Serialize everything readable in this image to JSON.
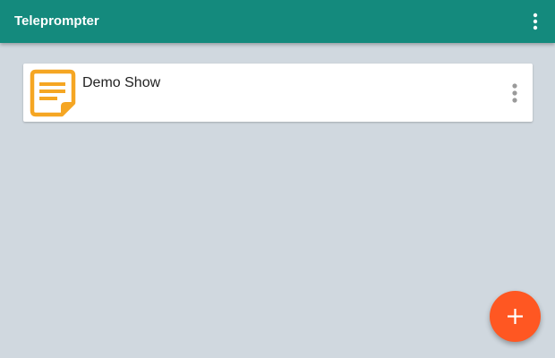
{
  "app_bar": {
    "title": "Teleprompter",
    "menu_icon": "more-vert-icon"
  },
  "scripts": [
    {
      "title": "Demo Show",
      "icon": "note-icon",
      "menu_icon": "more-vert-icon"
    }
  ],
  "fab": {
    "icon": "plus-icon"
  },
  "colors": {
    "app_bar": "#148a7d",
    "background": "#d0d8df",
    "note_icon": "#f5a623",
    "fab": "#ff5722",
    "card": "#ffffff"
  }
}
